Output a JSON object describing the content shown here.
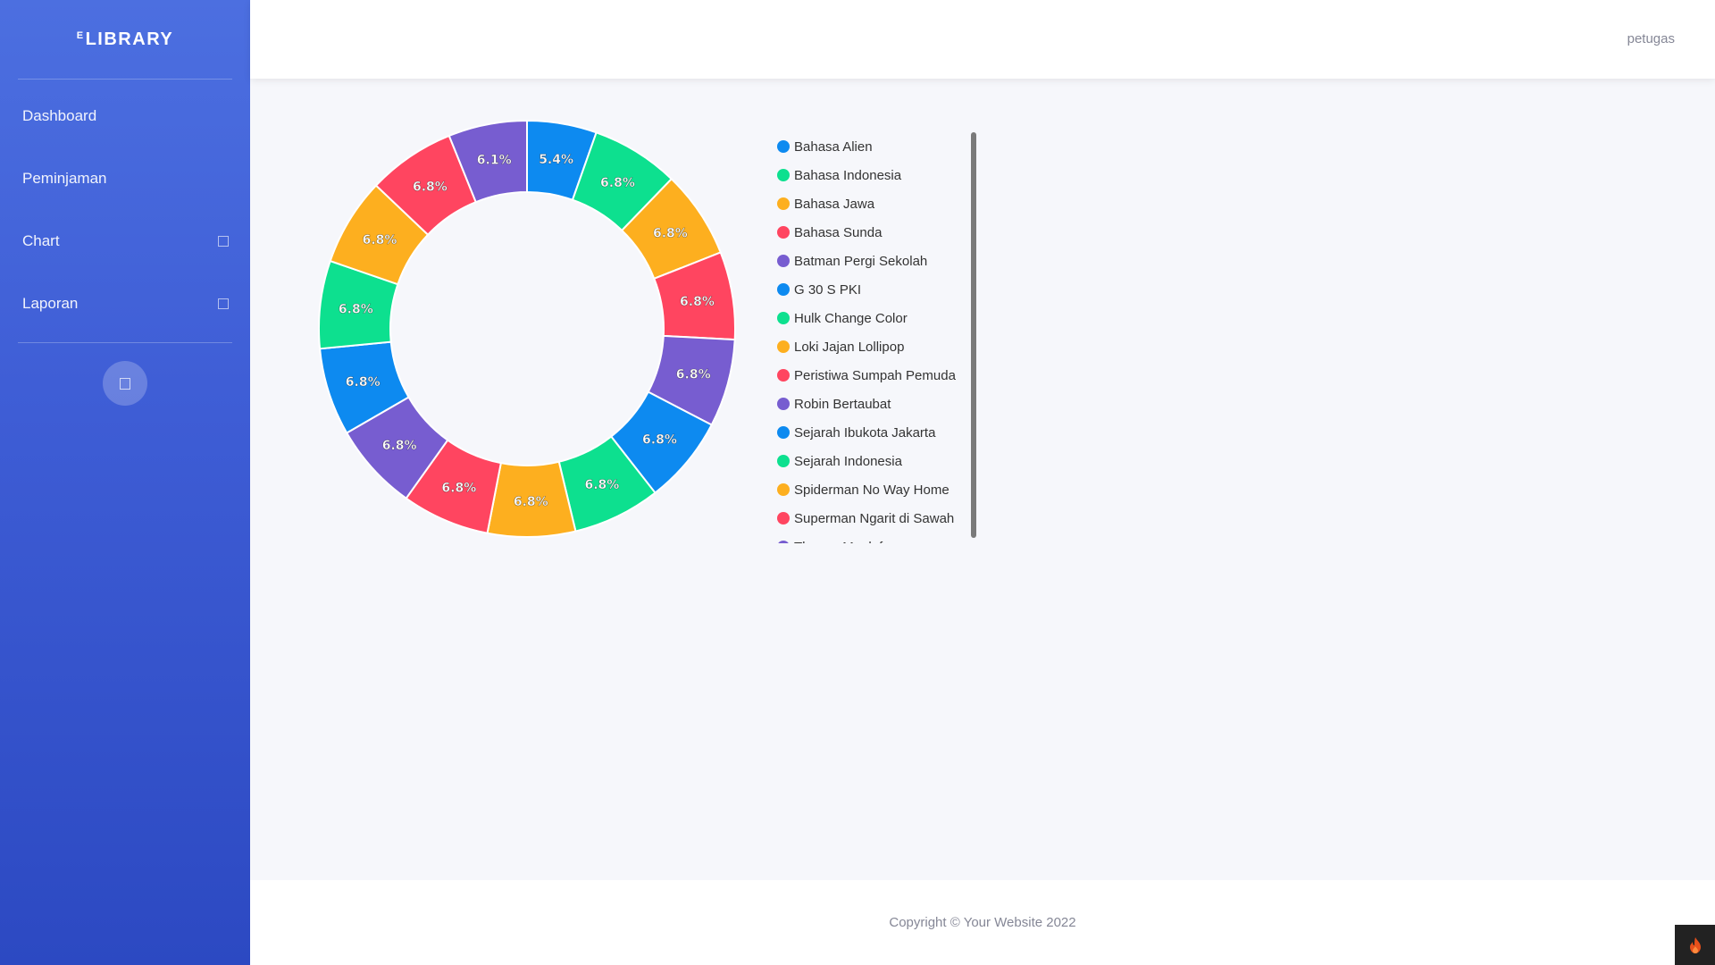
{
  "brand": {
    "sup": "E",
    "text": "LIBRARY"
  },
  "sidebar": {
    "items": [
      {
        "label": "Dashboard"
      },
      {
        "label": "Peminjaman"
      },
      {
        "label": "Chart"
      },
      {
        "label": "Laporan"
      }
    ]
  },
  "topbar": {
    "user": "petugas"
  },
  "footer": {
    "text": "Copyright © Your Website 2022"
  },
  "colors": {
    "blue": "#0d8af0",
    "green": "#0de08f",
    "orange": "#fdaf1f",
    "red": "#ff4560",
    "purple": "#775dd0"
  },
  "chart_data": {
    "type": "pie",
    "variant": "donut",
    "categories": [
      "Bahasa Alien",
      "Bahasa Indonesia",
      "Bahasa Jawa",
      "Bahasa Sunda",
      "Batman Pergi Sekolah",
      "G 30 S PKI",
      "Hulk Change Color",
      "Loki Jajan Lollipop",
      "Peristiwa Sumpah Pemuda",
      "Robin Bertaubat",
      "Sejarah Ibukota Jakarta",
      "Sejarah Indonesia",
      "Spiderman No Way Home",
      "Superman Ngarit di Sawah",
      "Thanos Mualaf"
    ],
    "values": [
      5.4,
      6.8,
      6.8,
      6.8,
      6.8,
      6.8,
      6.8,
      6.8,
      6.8,
      6.8,
      6.8,
      6.8,
      6.8,
      6.8,
      6.1
    ],
    "labels": [
      "5.4%",
      "6.8%",
      "6.8%",
      "6.8%",
      "6.8%",
      "6.8%",
      "6.8%",
      "6.8%",
      "6.8%",
      "6.8%",
      "6.8%",
      "6.8%",
      "6.8%",
      "6.8%",
      "6.1%"
    ],
    "legend_position": "right"
  }
}
